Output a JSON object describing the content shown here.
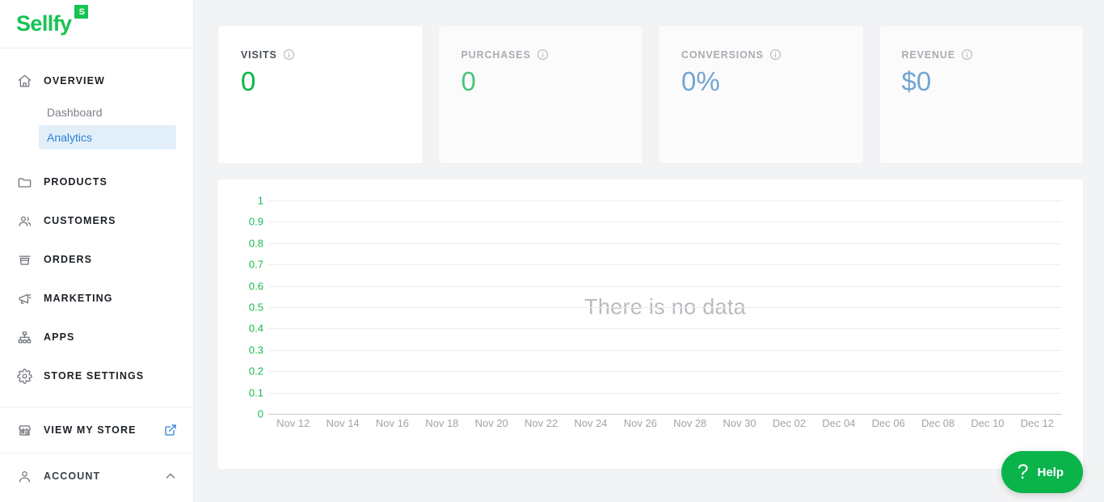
{
  "brand": {
    "name": "Sellfy",
    "badge": "S",
    "color": "#16c453"
  },
  "sidebar": {
    "overview": {
      "label": "OVERVIEW",
      "icon": "home-icon",
      "children": [
        {
          "label": "Dashboard",
          "active": false
        },
        {
          "label": "Analytics",
          "active": true
        }
      ]
    },
    "items": [
      {
        "label": "PRODUCTS",
        "icon": "folder-icon"
      },
      {
        "label": "CUSTOMERS",
        "icon": "users-icon"
      },
      {
        "label": "ORDERS",
        "icon": "basket-icon"
      },
      {
        "label": "MARKETING",
        "icon": "megaphone-icon"
      },
      {
        "label": "APPS",
        "icon": "sitemap-icon"
      },
      {
        "label": "STORE SETTINGS",
        "icon": "gear-icon"
      }
    ],
    "view_store": {
      "label": "VIEW MY STORE",
      "icon": "store-icon",
      "external_icon": "external-link-icon"
    },
    "account": {
      "label": "ACCOUNT",
      "icon": "user-icon",
      "chevron": "chevron-up-icon"
    }
  },
  "cards": [
    {
      "title": "VISITS",
      "value": "0",
      "color": "#00b843",
      "active": true,
      "info": "info-icon"
    },
    {
      "title": "PURCHASES",
      "value": "0",
      "color": "#4bc47e",
      "active": false,
      "info": "info-icon"
    },
    {
      "title": "CONVERSIONS",
      "value": "0%",
      "color": "#72a5d4",
      "active": false,
      "info": "info-icon"
    },
    {
      "title": "REVENUE",
      "value": "$0",
      "color": "#72a5d4",
      "active": false,
      "info": "info-icon"
    }
  ],
  "chart": {
    "empty_message": "There is no data"
  },
  "help": {
    "label": "Help",
    "glyph": "?",
    "color": "#0ab44b"
  },
  "chart_data": {
    "type": "line",
    "title": "",
    "xlabel": "",
    "ylabel": "",
    "ylim": [
      0,
      1
    ],
    "yticks": [
      0,
      0.1,
      0.2,
      0.3,
      0.4,
      0.5,
      0.6,
      0.7,
      0.8,
      0.9,
      1
    ],
    "ytick_labels": [
      "0",
      "0.1",
      "0.2",
      "0.3",
      "0.4",
      "0.5",
      "0.6",
      "0.7",
      "0.8",
      "0.9",
      "1"
    ],
    "xtick_labels": [
      "Nov 12",
      "Nov 14",
      "Nov 16",
      "Nov 18",
      "Nov 20",
      "Nov 22",
      "Nov 24",
      "Nov 26",
      "Nov 28",
      "Nov 30",
      "Dec 02",
      "Dec 04",
      "Dec 06",
      "Dec 08",
      "Dec 10",
      "Dec 12"
    ],
    "series": [
      {
        "name": "Visits",
        "values": []
      }
    ],
    "grid": true,
    "legend": false,
    "empty": true,
    "empty_message": "There is no data",
    "axis_color": "#18bb4c",
    "xtick_color": "#9fa4aa"
  }
}
